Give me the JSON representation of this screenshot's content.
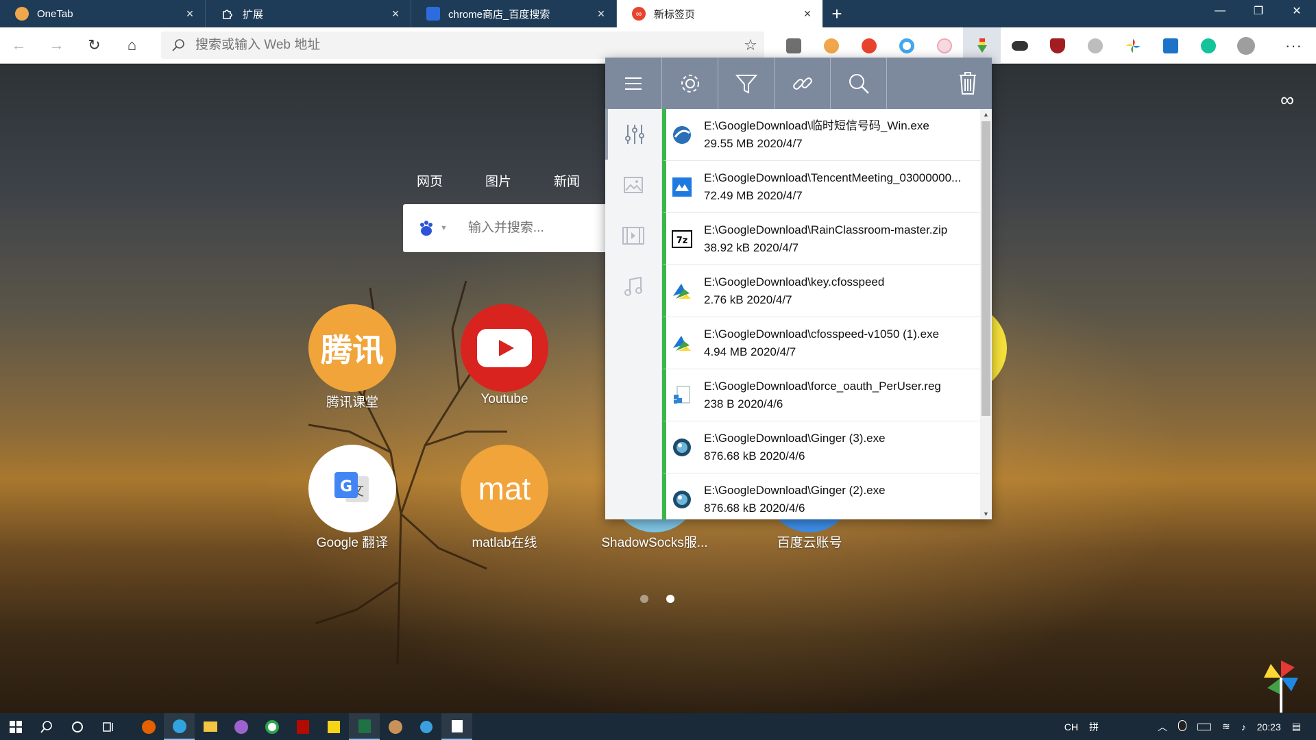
{
  "tabs": [
    {
      "title": "OneTab",
      "favicon_color": "#f0a64b",
      "close": "×"
    },
    {
      "title": "扩展",
      "favicon_color": "#1e3c57",
      "close": "×"
    },
    {
      "title": "chrome商店_百度搜索",
      "favicon_color": "#2d6cdf",
      "close": "×"
    },
    {
      "title": "新标签页",
      "favicon_color": "#e8432d",
      "close": "×"
    }
  ],
  "new_tab_symbol": "+",
  "window_controls": {
    "minimize": "—",
    "maximize": "❐",
    "close": "✕"
  },
  "toolbar": {
    "back": "←",
    "forward": "→",
    "reload": "↻",
    "home": "⌂",
    "omnibox_placeholder": "搜索或输入 Web 地址",
    "star": "☆",
    "more": "···"
  },
  "extensions": [
    {
      "name": "ext-reader-icon",
      "color": "#6f6f6f"
    },
    {
      "name": "ext-orange-icon",
      "color": "#f0a64b"
    },
    {
      "name": "ext-infinity-icon",
      "color": "#e8432d"
    },
    {
      "name": "ext-blue-circle-icon",
      "color": "#43a6f0"
    },
    {
      "name": "ext-cat-icon",
      "color": "#f2a6b8"
    },
    {
      "name": "ext-download-icon",
      "color": "#3aa24a"
    },
    {
      "name": "ext-glasses-icon",
      "color": "#333333"
    },
    {
      "name": "ext-ublock-icon",
      "color": "#a11d21"
    },
    {
      "name": "ext-ghost-icon",
      "color": "#bdbdbd"
    },
    {
      "name": "ext-pinwheel-icon",
      "color": "#4caf50"
    },
    {
      "name": "ext-s-icon",
      "color": "#1d73c8"
    },
    {
      "name": "ext-grammarly-icon",
      "color": "#15c39a"
    },
    {
      "name": "ext-profile-icon",
      "color": "#9e9e9e"
    }
  ],
  "newtab": {
    "search_tabs": [
      "网页",
      "图片",
      "新闻"
    ],
    "search_placeholder": "输入并搜索...",
    "shortcuts": [
      {
        "label": "腾讯课堂",
        "text": "腾讯",
        "color": "#f0a43a"
      },
      {
        "label": "Youtube",
        "text": "",
        "color": "#d9231f"
      },
      {
        "label": "Google 翻译",
        "text": "",
        "color": "#ffffff"
      },
      {
        "label": "matlab在线",
        "text": "mat",
        "color": "#f0a43a"
      },
      {
        "label": "ShadowSocks服...",
        "text": "",
        "color": "#7fc6e8"
      },
      {
        "label": "百度云账号",
        "text": "",
        "color": "#3d8ee8"
      }
    ],
    "infinity": "∞"
  },
  "downloads_popup": {
    "toolbar": [
      "menu-icon",
      "settings-icon",
      "filter-icon",
      "link-icon",
      "search-icon",
      "trash-icon"
    ],
    "sidebar": [
      "sliders-icon",
      "image-icon",
      "video-icon",
      "music-icon"
    ],
    "items": [
      {
        "path": "E:\\GoogleDownload\\临时短信号码_Win.exe",
        "size": "29.55 MB",
        "date": "2020/4/7",
        "icon": "globe-app-icon",
        "icon_color": "#2a6fb8"
      },
      {
        "path": "E:\\GoogleDownload\\TencentMeeting_03000000...",
        "size": "72.49 MB",
        "date": "2020/4/7",
        "icon": "tencent-meeting-icon",
        "icon_color": "#1f7ae0"
      },
      {
        "path": "E:\\GoogleDownload\\RainClassroom-master.zip",
        "size": "38.92 kB",
        "date": "2020/4/7",
        "icon": "7zip-icon",
        "icon_color": "#000000"
      },
      {
        "path": "E:\\GoogleDownload\\key.cfosspeed",
        "size": "2.76 kB",
        "date": "2020/4/7",
        "icon": "cfosspeed-icon",
        "icon_color": "#1976d2"
      },
      {
        "path": "E:\\GoogleDownload\\cfosspeed-v1050 (1).exe",
        "size": "4.94 MB",
        "date": "2020/4/7",
        "icon": "cfosspeed-icon",
        "icon_color": "#1976d2"
      },
      {
        "path": "E:\\GoogleDownload\\force_oauth_PerUser.reg",
        "size": "238 B",
        "date": "2020/4/6",
        "icon": "registry-icon",
        "icon_color": "#2d86d6"
      },
      {
        "path": "E:\\GoogleDownload\\Ginger (3).exe",
        "size": "876.68 kB",
        "date": "2020/4/6",
        "icon": "ginger-icon",
        "icon_color": "#1b4c6b"
      },
      {
        "path": "E:\\GoogleDownload\\Ginger (2).exe",
        "size": "876.68 kB",
        "date": "2020/4/6",
        "icon": "ginger-icon",
        "icon_color": "#1b4c6b"
      }
    ]
  },
  "taskbar": {
    "items": [
      "windows-start-icon",
      "search-icon",
      "cortana-icon",
      "task-view-icon",
      "firefox-icon",
      "edge-icon",
      "file-explorer-icon",
      "onenote-icon",
      "360-icon",
      "acrobat-icon",
      "sticky-notes-icon",
      "excel-icon",
      "app-icon",
      "app-icon-2",
      "app-icon-3"
    ],
    "tray": {
      "lang": "CH",
      "ime": "拼",
      "time": "20:23"
    }
  }
}
